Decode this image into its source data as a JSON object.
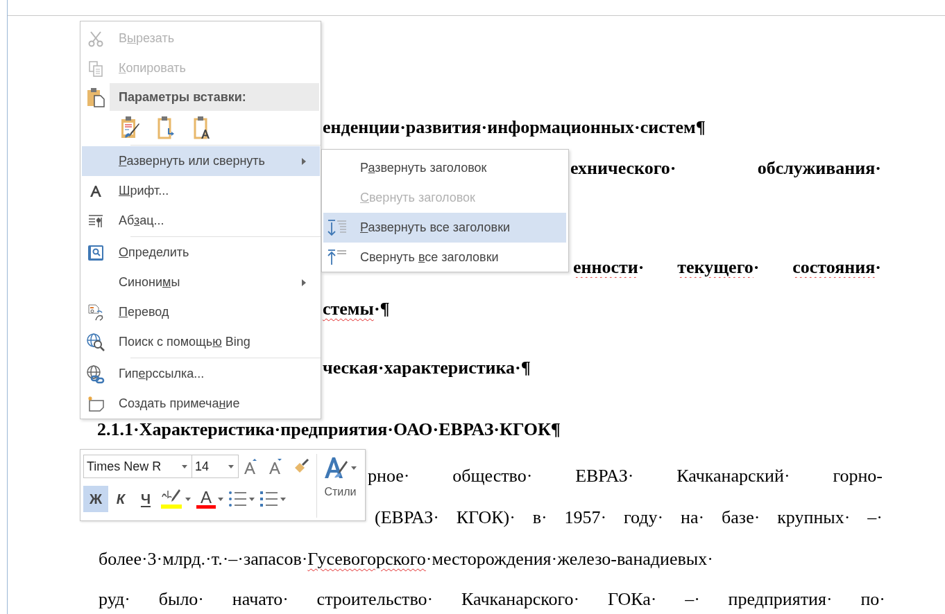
{
  "document": {
    "lines": [
      {
        "kind": "heading",
        "segments": [
          {
            "text": "енденции·развития·информационных·систем¶",
            "misspelled": false
          }
        ]
      },
      {
        "kind": "heading",
        "segments": [
          {
            "text": "ехнического· обслуживания·",
            "misspelled": false
          }
        ]
      },
      {
        "kind": "heading",
        "segments": [
          {
            "text": "енности",
            "misspelled": true
          },
          {
            "text": "· ",
            "misspelled": false
          },
          {
            "text": "текущего",
            "misspelled": true
          },
          {
            "text": "· ",
            "misspelled": false
          },
          {
            "text": "состояния",
            "misspelled": true
          },
          {
            "text": "·",
            "misspelled": false
          }
        ]
      },
      {
        "kind": "heading",
        "segments": [
          {
            "text": "стемы",
            "misspelled": true
          },
          {
            "text": "·¶",
            "misspelled": false
          }
        ]
      },
      {
        "kind": "heading",
        "segments": [
          {
            "text": "ческая·характеристика·¶",
            "misspelled": false
          }
        ]
      },
      {
        "kind": "heading",
        "segments": [
          {
            "text": "2.1.1·Характеристика·предприятия·ОАО·ЕВРАЗ·КГОК¶",
            "misspelled": false
          }
        ]
      },
      {
        "kind": "body",
        "segments": [
          {
            "text": "рное· общество· ЕВРАЗ· Качканарский· горно-",
            "misspelled": false
          }
        ]
      },
      {
        "kind": "body",
        "segments": [
          {
            "text": "(ЕВРАЗ· КГОК)· в· 1957· году· на· базе· крупных· –·",
            "misspelled": false
          }
        ]
      },
      {
        "kind": "body",
        "segments": [
          {
            "text": "более·3·млрд.·т.·–·запасов·",
            "misspelled": false
          },
          {
            "text": "Гусевогорского",
            "misspelled": true
          },
          {
            "text": "·месторождения·железо-ванадиевых·",
            "misspelled": false
          }
        ]
      },
      {
        "kind": "body",
        "segments": [
          {
            "text": "руд· было· начато· строительство· Качканарского· ГОКа· –· предприятия· по·",
            "misspelled": false
          }
        ]
      }
    ]
  },
  "context_menu": {
    "items": [
      {
        "kind": "command",
        "label": {
          "pre": "В",
          "key": "ы",
          "post": "резать"
        },
        "disabled": true,
        "selected": false,
        "submenu": false
      },
      {
        "kind": "command",
        "label": {
          "key": "К",
          "post": "опировать"
        },
        "disabled": true,
        "selected": false,
        "submenu": false
      },
      {
        "kind": "header",
        "label": {
          "pre": "Параметры вставки:"
        }
      },
      {
        "kind": "paste_options"
      },
      {
        "kind": "separator"
      },
      {
        "kind": "command",
        "label": {
          "key": "Р",
          "post": "азвернуть или свернуть"
        },
        "disabled": false,
        "selected": true,
        "submenu": true
      },
      {
        "kind": "command",
        "label": {
          "key": "Ш",
          "post": "рифт..."
        },
        "disabled": false,
        "selected": false,
        "submenu": false
      },
      {
        "kind": "command",
        "label": {
          "pre": "Аб",
          "key": "з",
          "post": "ац..."
        },
        "disabled": false,
        "selected": false,
        "submenu": false
      },
      {
        "kind": "separator"
      },
      {
        "kind": "command",
        "label": {
          "key": "О",
          "post": "пределить"
        },
        "disabled": false,
        "selected": false,
        "submenu": false
      },
      {
        "kind": "command",
        "label": {
          "pre": "Синони",
          "key": "м",
          "post": "ы"
        },
        "disabled": false,
        "selected": false,
        "submenu": true
      },
      {
        "kind": "command",
        "label": {
          "key": "П",
          "post": "еревод"
        },
        "disabled": false,
        "selected": false,
        "submenu": false
      },
      {
        "kind": "command",
        "label": {
          "pre": "Поиск с помощь",
          "key": "ю",
          "post": " Bing"
        },
        "disabled": false,
        "selected": false,
        "submenu": false
      },
      {
        "kind": "separator"
      },
      {
        "kind": "command",
        "label": {
          "pre": "Гип",
          "key": "е",
          "post": "рссылка..."
        },
        "disabled": false,
        "selected": false,
        "submenu": false
      },
      {
        "kind": "command",
        "label": {
          "pre": "Создать примеча",
          "key": "н",
          "post": "ие"
        },
        "disabled": false,
        "selected": false,
        "submenu": false
      }
    ]
  },
  "submenu": {
    "items": [
      {
        "label": {
          "pre": "Р",
          "key": "а",
          "post": "звернуть заголовок"
        },
        "disabled": false,
        "selected": false
      },
      {
        "label": {
          "key": "С",
          "post": "вернуть заголовок"
        },
        "disabled": true,
        "selected": false
      },
      {
        "label": {
          "key": "Р",
          "post": "азвернуть все заголовки"
        },
        "disabled": false,
        "selected": true
      },
      {
        "label": {
          "pre": "Свернуть ",
          "key": "в",
          "post": "се заголовки"
        },
        "disabled": false,
        "selected": false
      }
    ]
  },
  "mini_toolbar": {
    "font": "Times New R",
    "size": "14",
    "styles_label": "Стили",
    "format_buttons": [
      {
        "kind": "bold",
        "label": "Ж",
        "selected": true
      },
      {
        "kind": "italic",
        "label": "К",
        "selected": false
      },
      {
        "kind": "underline",
        "label": "Ч",
        "selected": false
      },
      {
        "kind": "highlight",
        "color": "#ffff00",
        "selected": false
      },
      {
        "kind": "font_color",
        "label": "A",
        "color": "#ff0000",
        "selected": false
      },
      {
        "kind": "bullets",
        "selected": false
      },
      {
        "kind": "numbering",
        "selected": false
      }
    ]
  }
}
